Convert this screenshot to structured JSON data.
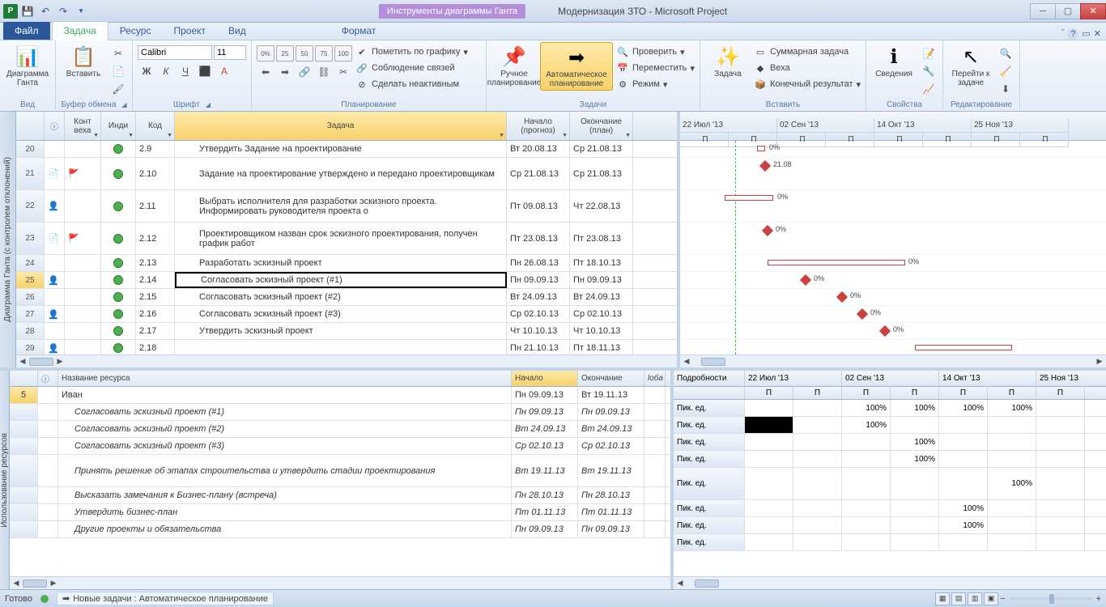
{
  "title": "Модернизация ЗТО - Microsoft Project",
  "context_tab": "Инструменты диаграммы Ганта",
  "tabs": {
    "file": "Файл",
    "task": "Задача",
    "resource": "Ресурс",
    "project": "Проект",
    "view": "Вид",
    "format": "Формат"
  },
  "ribbon": {
    "view_group": "Вид",
    "gantt_btn": "Диаграмма Ганта",
    "clipboard_group": "Буфер обмена",
    "paste_btn": "Вставить",
    "font_group": "Шрифт",
    "font_name": "Calibri",
    "font_size": "11",
    "schedule_group": "Планирование",
    "mark_track": "Пометить по графику",
    "respect_links": "Соблюдение связей",
    "inactivate": "Сделать неактивным",
    "tasks_group": "Задачи",
    "manual": "Ручное планирование",
    "auto": "Автоматическое планирование",
    "check": "Проверить",
    "move": "Переместить",
    "mode": "Режим",
    "insert_group": "Вставить",
    "task_btn": "Задача",
    "summary": "Суммарная задача",
    "milestone": "Веха",
    "deliverable": "Конечный результат",
    "props_group": "Свойства",
    "info_btn": "Сведения",
    "edit_group": "Редактирование",
    "goto": "Перейти к задаче"
  },
  "vlabels": {
    "top": "Диаграмма Ганта (с контролем отклонений)",
    "bottom": "Использование ресурсов"
  },
  "cols": {
    "kv": "Конт веха",
    "ind": "Инди",
    "kod": "Код",
    "task": "Задача",
    "start": "Начало (прогноз)",
    "end": "Окончание (план)"
  },
  "rows": [
    {
      "n": "20",
      "ind": "g",
      "kod": "2.9",
      "task": "Утвердить Задание на проектирование",
      "start": "Вт 20.08.13",
      "end": "Ср 21.08.13"
    },
    {
      "n": "21",
      "info": "note",
      "kv": "flag",
      "ind": "g",
      "kod": "2.10",
      "task": "Задание на проектирование утверждено и передано проектировщикам",
      "start": "Ср 21.08.13",
      "end": "Ср 21.08.13",
      "tall": true
    },
    {
      "n": "22",
      "info": "person",
      "ind": "g",
      "kod": "2.11",
      "task": "Выбрать исполнителя для разработки эскизного проекта. Информировать руководителя проекта о",
      "start": "Пт 09.08.13",
      "end": "Чт 22.08.13",
      "tall": true
    },
    {
      "n": "23",
      "info": "note",
      "kv": "flag",
      "ind": "g",
      "kod": "2.12",
      "task": "Проектировщиком назван срок эскизного проектирования, получен график работ",
      "start": "Пт 23.08.13",
      "end": "Пт 23.08.13",
      "tall": true
    },
    {
      "n": "24",
      "ind": "g",
      "kod": "2.13",
      "task": "Разработать эскизный проект",
      "start": "Пн 26.08.13",
      "end": "Пт 18.10.13"
    },
    {
      "n": "25",
      "info": "person",
      "ind": "g",
      "kod": "2.14",
      "task": "Согласовать эскизный проект (#1)",
      "start": "Пн 09.09.13",
      "end": "Пн 09.09.13",
      "sel": true
    },
    {
      "n": "26",
      "ind": "g",
      "kod": "2.15",
      "task": "Согласовать эскизный проект (#2)",
      "start": "Вт 24.09.13",
      "end": "Вт 24.09.13"
    },
    {
      "n": "27",
      "info": "person",
      "ind": "g",
      "kod": "2.16",
      "task": "Согласовать эскизный проект (#3)",
      "start": "Ср 02.10.13",
      "end": "Ср 02.10.13"
    },
    {
      "n": "28",
      "ind": "g",
      "kod": "2.17",
      "task": "Утвердить эскизный проект",
      "start": "Чт 10.10.13",
      "end": "Чт 10.10.13"
    },
    {
      "n": "29",
      "info": "person",
      "ind": "g",
      "kod": "2.18",
      "task": "",
      "start": "Пн 21.10.13",
      "end": "Пт 18.11.13"
    }
  ],
  "timeline": {
    "dates": [
      "22 Июл '13",
      "02 Сен '13",
      "14 Окт '13",
      "25 Ноя '13"
    ],
    "sub": [
      "П",
      "П",
      "П",
      "П",
      "П",
      "П",
      "П",
      "П"
    ]
  },
  "gantt_labels": {
    "pct0": "0%",
    "ms": "21.08"
  },
  "res_cols": {
    "name": "Название ресурса",
    "start": "Начало",
    "end": "Окончание",
    "ext": "loба"
  },
  "res_rows": [
    {
      "n": "5",
      "name": "Иван",
      "start": "Пн 09.09.13",
      "end": "Вт 19.11.13",
      "head": true
    },
    {
      "name": "Согласовать эскизный проект (#1)",
      "start": "Пн 09.09.13",
      "end": "Пн 09.09.13",
      "ital": true
    },
    {
      "name": "Согласовать эскизный проект (#2)",
      "start": "Вт 24.09.13",
      "end": "Вт 24.09.13",
      "ital": true
    },
    {
      "name": "Согласовать эскизный проект (#3)",
      "start": "Ср 02.10.13",
      "end": "Ср 02.10.13",
      "ital": true
    },
    {
      "name": "Принять решение об этапах строительства  и утвердить стадии проектирования",
      "start": "Вт 19.11.13",
      "end": "Вт 19.11.13",
      "ital": true,
      "tall": true
    },
    {
      "name": "Высказать замечания к Бизнес-плану (встреча)",
      "start": "Пн 28.10.13",
      "end": "Пн 28.10.13",
      "ital": true
    },
    {
      "name": "Утвердить бизнес-план",
      "start": "Пт 01.11.13",
      "end": "Пт 01.11.13",
      "ital": true
    },
    {
      "name": "Другие проекты и обязательства",
      "start": "Пн 09.09.13",
      "end": "Пн 09.09.13",
      "ital": true
    }
  ],
  "details": {
    "header": "Подробности",
    "unit": "Пик. ед.",
    "grid": [
      [
        "",
        "",
        "100%",
        "100%",
        "100%",
        "100%",
        ""
      ],
      [
        "dark",
        "",
        "100%",
        "",
        "",
        "",
        ""
      ],
      [
        "",
        "",
        "",
        "100%",
        "",
        "",
        ""
      ],
      [
        "",
        "",
        "",
        "100%",
        "",
        "",
        ""
      ],
      [
        "",
        "",
        "",
        "",
        "",
        "100%",
        ""
      ],
      [
        "",
        "",
        "",
        "",
        "100%",
        "",
        ""
      ],
      [
        "",
        "",
        "",
        "",
        "100%",
        "",
        ""
      ],
      [
        "",
        "",
        "",
        "",
        "",
        "",
        ""
      ]
    ]
  },
  "status": {
    "ready": "Готово",
    "mode": "Новые задачи : Автоматическое планирование"
  }
}
